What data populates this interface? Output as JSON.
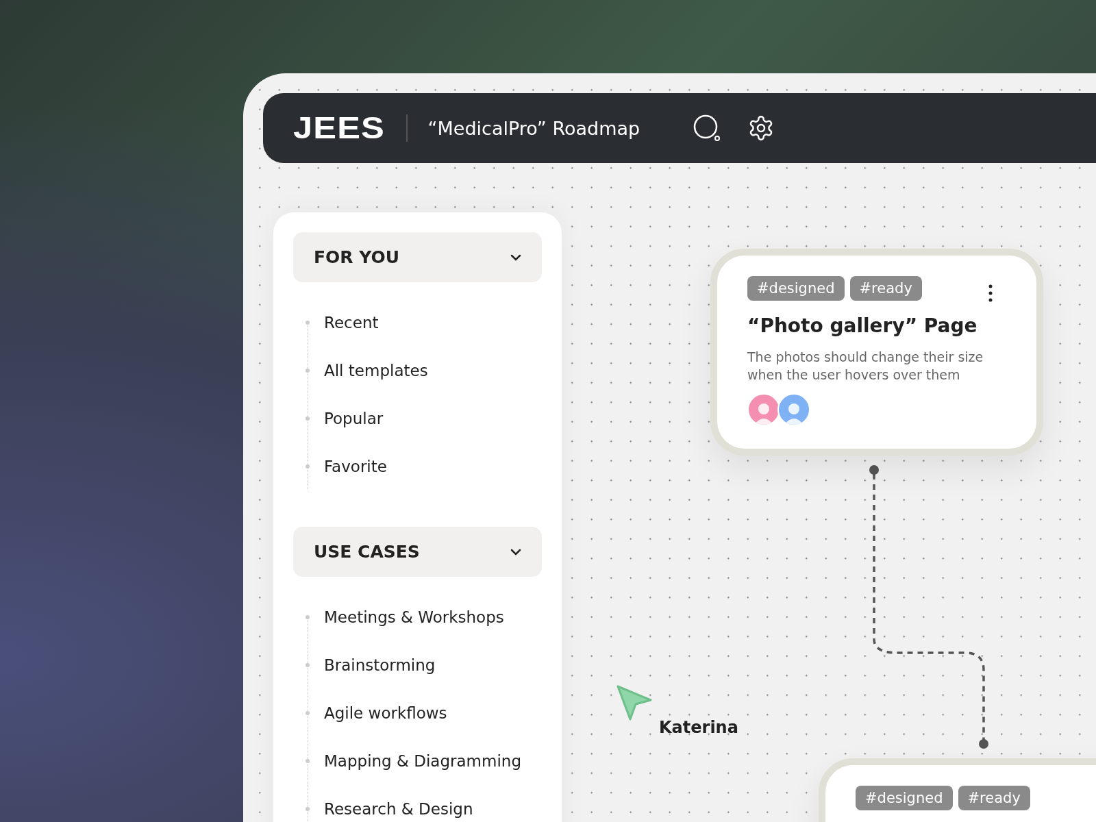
{
  "header": {
    "logo": "JEES",
    "title": "“MedicalPro” Roadmap"
  },
  "sidebar": {
    "sections": [
      {
        "title": "FOR YOU",
        "expanded": true,
        "items": [
          "Recent",
          "All templates",
          "Popular",
          "Favorite"
        ]
      },
      {
        "title": "USE CASES",
        "expanded": true,
        "items": [
          "Meetings & Workshops",
          "Brainstorming",
          "Agile workflows",
          "Mapping & Diagramming",
          "Research & Design"
        ]
      }
    ]
  },
  "canvas": {
    "cards": [
      {
        "tags": [
          "#designed",
          "#ready"
        ],
        "title": "“Photo gallery” Page",
        "description": "The photos should change their size when the user hovers over them",
        "avatars": [
          {
            "color": "#f48fb1"
          },
          {
            "color": "#7fb2f5"
          }
        ]
      },
      {
        "tags": [
          "#designed",
          "#ready"
        ]
      }
    ],
    "cursor": {
      "user": "Katerina"
    }
  }
}
